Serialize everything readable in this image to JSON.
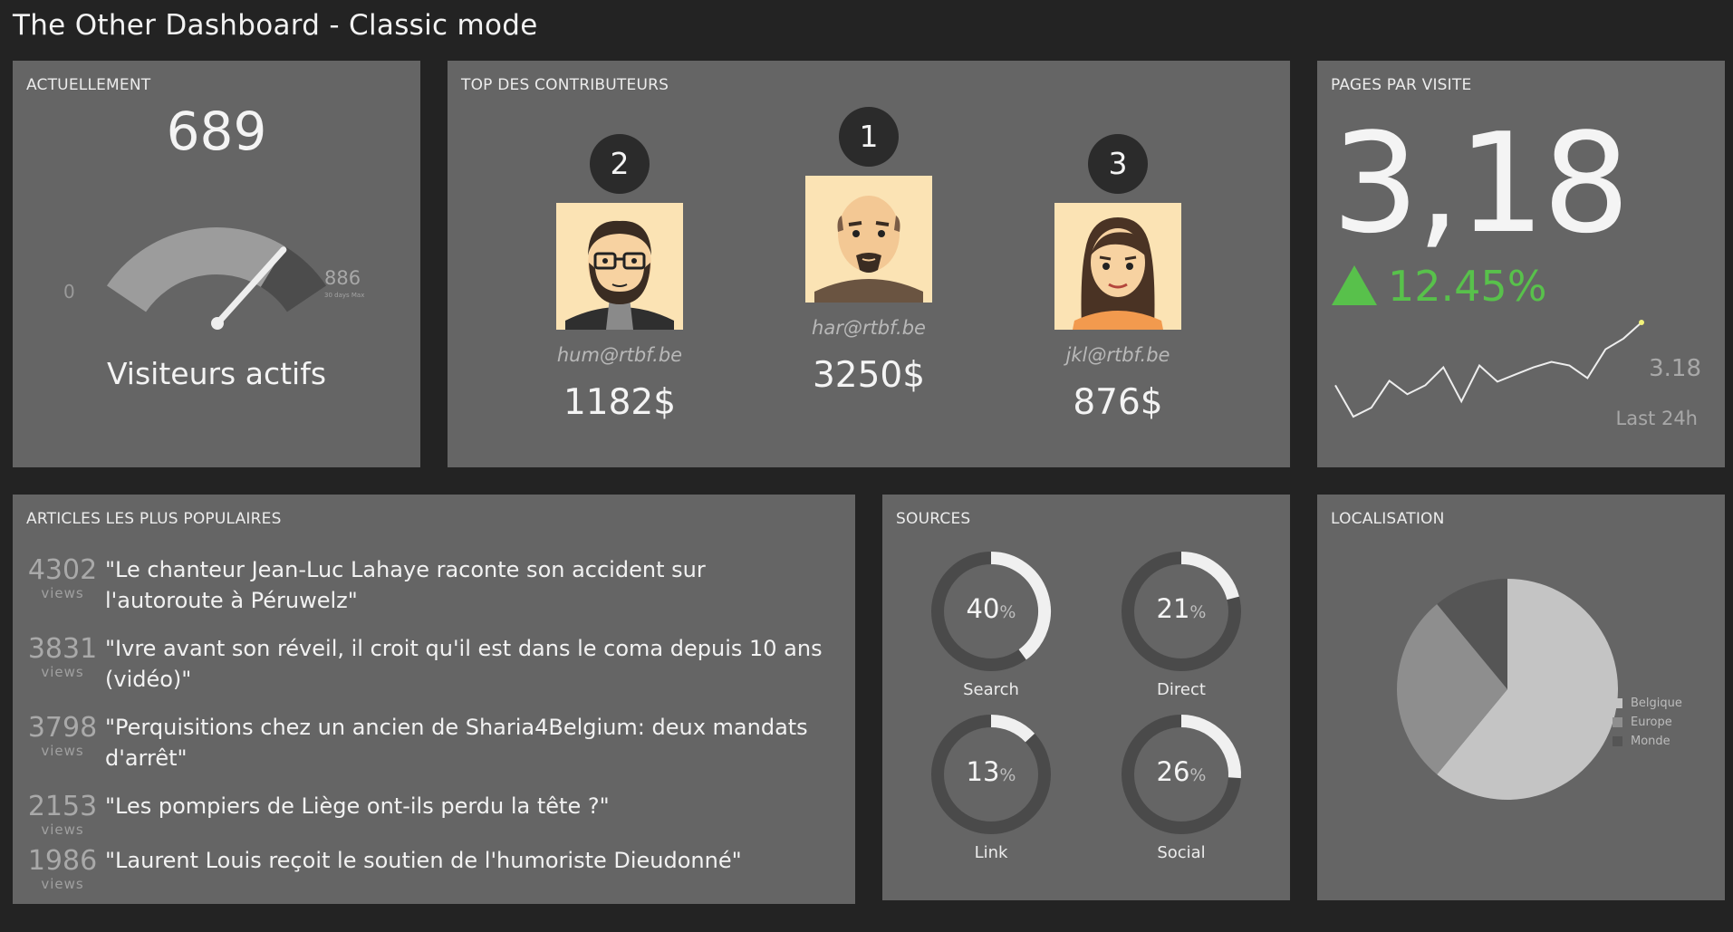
{
  "app": {
    "title": "The Other Dashboard - Classic mode"
  },
  "actuellement": {
    "title": "ACTUELLEMENT",
    "value": "689",
    "gauge_min": "0",
    "gauge_max": "886",
    "gauge_max_sub": "30 days Max",
    "gauge_level": 0.78,
    "label": "Visiteurs actifs"
  },
  "contributors": {
    "title": "TOP DES CONTRIBUTEURS",
    "items": [
      {
        "rank": "2",
        "email": "hum@rtbf.be",
        "amount": "1182$"
      },
      {
        "rank": "1",
        "email": "har@rtbf.be",
        "amount": "3250$"
      },
      {
        "rank": "3",
        "email": "jkl@rtbf.be",
        "amount": "876$"
      }
    ]
  },
  "pages_par_visite": {
    "title": "PAGES PAR VISITE",
    "value": "3,18",
    "trend": "12.45%",
    "trend_direction": "up",
    "trend_color": "#58c14b",
    "last_value": "3.18",
    "period": "Last 24h"
  },
  "articles": {
    "title": "ARTICLES LES PLUS POPULAIRES",
    "views_label": "views",
    "items": [
      {
        "views": "4302",
        "title": "\"Le chanteur Jean-Luc Lahaye raconte son accident sur l'autoroute à Péruwelz\""
      },
      {
        "views": "3831",
        "title": "\"Ivre avant son réveil, il croit qu'il est dans le coma depuis 10 ans (vidéo)\""
      },
      {
        "views": "3798",
        "title": "\"Perquisitions chez un ancien de Sharia4Belgium: deux mandats d'arrêt\""
      },
      {
        "views": "2153",
        "title": "\"Les pompiers de Liège ont-ils perdu la tête ?\""
      },
      {
        "views": "1986",
        "title": "\"Laurent Louis reçoit le soutien de l'humoriste Dieudonné\""
      }
    ]
  },
  "sources": {
    "title": "SOURCES",
    "percent_sign": "%",
    "items": [
      {
        "name": "Search",
        "value": "40",
        "fraction": 0.4
      },
      {
        "name": "Direct",
        "value": "21",
        "fraction": 0.21
      },
      {
        "name": "Link",
        "value": "13",
        "fraction": 0.13
      },
      {
        "name": "Social",
        "value": "26",
        "fraction": 0.26
      }
    ]
  },
  "localisation": {
    "title": "LOCALISATION",
    "legend": [
      "Belgique",
      "Europe",
      "Monde"
    ],
    "colors": [
      "#c4c4c4",
      "#8e8e8e",
      "#555555"
    ],
    "shares": [
      0.61,
      0.28,
      0.11
    ]
  },
  "chart_data": [
    {
      "type": "line",
      "x": [
        1,
        2,
        3,
        4,
        5,
        6,
        7,
        8,
        9,
        10,
        11,
        12,
        13,
        14,
        15,
        16,
        17,
        18
      ],
      "values": [
        2.9,
        2.55,
        2.65,
        2.95,
        2.8,
        2.9,
        3.1,
        2.72,
        3.12,
        2.94,
        3.02,
        3.1,
        3.16,
        3.12,
        2.98,
        3.3,
        3.42,
        3.6
      ],
      "title": "",
      "xlabel": "",
      "ylabel": ""
    },
    {
      "type": "pie",
      "categories": [
        "Belgique",
        "Europe",
        "Monde"
      ],
      "values": [
        61,
        28,
        11
      ],
      "legend": "right"
    }
  ]
}
